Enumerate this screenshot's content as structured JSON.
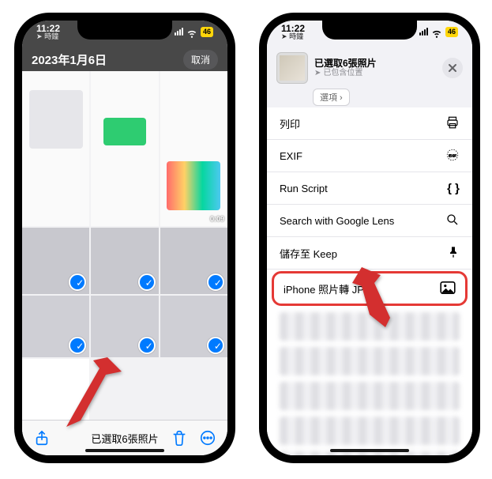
{
  "status": {
    "time": "11:22",
    "loc_label": "時鐘",
    "battery": "46"
  },
  "left": {
    "date_title": "2023年1月6日",
    "cancel": "取消",
    "video_duration": "0:09",
    "selected_summary": "已選取6張照片"
  },
  "right": {
    "header": {
      "title": "已選取6張照片",
      "subtitle": "已包含位置",
      "options_btn": "選項"
    },
    "actions": [
      {
        "label": "列印",
        "icon": "printer"
      },
      {
        "label": "EXIF",
        "icon": "exif"
      },
      {
        "label": "Run Script",
        "icon": "braces"
      },
      {
        "label": "Search with Google Lens",
        "icon": "search"
      },
      {
        "label": "儲存至 Keep",
        "icon": "keep"
      },
      {
        "label": "iPhone 照片轉 JPG",
        "icon": "image",
        "highlight": true
      }
    ]
  }
}
